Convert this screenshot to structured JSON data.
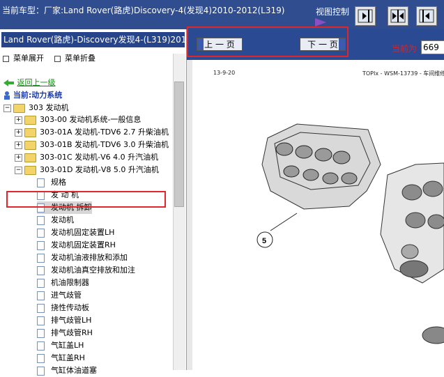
{
  "header": {
    "title": "当前车型：厂家:Land Rover(路虎)Discovery-4(发现4)2010-2012(L319)",
    "view_control": "视图控制"
  },
  "left_panel": {
    "doc_title": "Land Rover(路虎)-Discovery发现4-(L319)2010-2012",
    "expand_menu": "菜单展开",
    "collapse_menu": "菜单折叠",
    "back": "返回上一级",
    "current": "当前:动力系统",
    "root_folder": "303 发动机",
    "subfolders": [
      "303-00 发动机系统-一般信息",
      "303-01A 发动机-TDV6 2.7 升柴油机",
      "303-01B 发动机-TDV6 3.0 升柴油机",
      "303-01C 发动机-V6 4.0 升汽油机",
      "303-01D 发动机-V8 5.0 升汽油机"
    ],
    "items": [
      "规格",
      "发 动 机",
      "发动机 拆卸",
      "发动机",
      "发动机固定装置LH",
      "发动机固定装置RH",
      "发动机油液排放和添加",
      "发动机油真空排放和加注",
      "机油限制器",
      "进气歧管",
      "挠性传动板",
      "排气歧管LH",
      "排气歧管RH",
      "气缸盖LH",
      "气缸盖RH",
      "气缸体油道塞"
    ],
    "selected_index": 2
  },
  "toolbar": {
    "prev_page": "上 一 页",
    "next_page": "下 一 页",
    "current_page_label": "当前为",
    "current_page_value": "669"
  },
  "document": {
    "header_left": "13-9-20",
    "header_right": "TOPIx - WSM-13739 - 车间维修",
    "callout": "5"
  }
}
